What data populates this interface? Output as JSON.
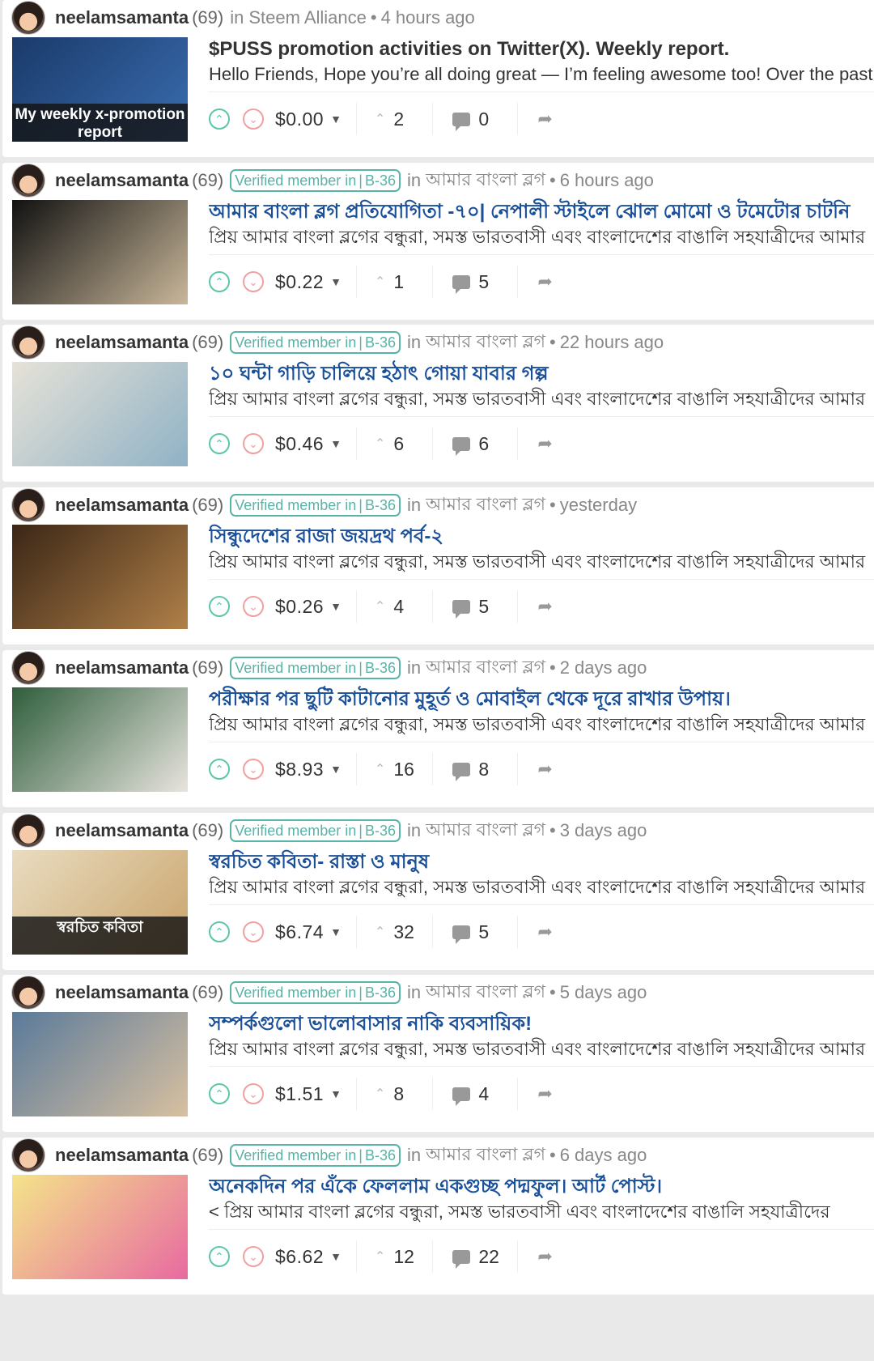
{
  "feed": {
    "posts": [
      {
        "author": "neelamsamanta",
        "reputation": "(69)",
        "badge": null,
        "in_label": "in",
        "community": "Steem Alliance",
        "time": "4 hours ago",
        "title": "$PUSS promotion activities on Twitter(X). Weekly report.",
        "summary": "Hello Friends, Hope you’re all doing great — I’m feeling awesome too! Over the past",
        "thumb_caption": "My weekly x-promotion report",
        "payout": "$0.00",
        "votes": "2",
        "comments": "0",
        "thumb_colors": [
          "#1a3a6a",
          "#3a6db0"
        ]
      },
      {
        "author": "neelamsamanta",
        "reputation": "(69)",
        "badge": {
          "text": "Verified member in",
          "sep": "|",
          "code": "B-36"
        },
        "in_label": "in",
        "community": "আমার বাংলা ব্লগ",
        "time": "6 hours ago",
        "title": "আমার বাংলা ব্লগ প্রতিযোগিতা -৭০| নেপালী স্টাইলে ঝোল মোমো ও টমেটোর চাটনি",
        "summary": "প্রিয় আমার বাংলা ব্লগের বন্ধুরা, সমস্ত ভারতবাসী এবং বাংলাদেশের বাঙালি সহযাত্রীদের আমার",
        "thumb_caption": "",
        "payout": "$0.22",
        "votes": "1",
        "comments": "5",
        "thumb_colors": [
          "#111111",
          "#c9b79a"
        ]
      },
      {
        "author": "neelamsamanta",
        "reputation": "(69)",
        "badge": {
          "text": "Verified member in",
          "sep": "|",
          "code": "B-36"
        },
        "in_label": "in",
        "community": "আমার বাংলা ব্লগ",
        "time": "22 hours ago",
        "title": "১০ ঘন্টা গাড়ি চালিয়ে হঠাৎ গোয়া যাবার গল্প",
        "summary": "প্রিয় আমার বাংলা ব্লগের বন্ধুরা, সমস্ত ভারতবাসী এবং বাংলাদেশের বাঙালি সহযাত্রীদের আমার",
        "thumb_caption": "",
        "payout": "$0.46",
        "votes": "6",
        "comments": "6",
        "thumb_colors": [
          "#e6e2d8",
          "#8fb2c6"
        ]
      },
      {
        "author": "neelamsamanta",
        "reputation": "(69)",
        "badge": {
          "text": "Verified member in",
          "sep": "|",
          "code": "B-36"
        },
        "in_label": "in",
        "community": "আমার বাংলা ব্লগ",
        "time": "yesterday",
        "title": "সিন্ধুদেশের রাজা জয়দ্রথ পর্ব-২",
        "summary": "প্রিয় আমার বাংলা ব্লগের বন্ধুরা, সমস্ত ভারতবাসী এবং বাংলাদেশের বাঙালি সহযাত্রীদের আমার",
        "thumb_caption": "",
        "payout": "$0.26",
        "votes": "4",
        "comments": "5",
        "thumb_colors": [
          "#3b2616",
          "#b08048"
        ]
      },
      {
        "author": "neelamsamanta",
        "reputation": "(69)",
        "badge": {
          "text": "Verified member in",
          "sep": "|",
          "code": "B-36"
        },
        "in_label": "in",
        "community": "আমার বাংলা ব্লগ",
        "time": "2 days ago",
        "title": "পরীক্ষার পর ছুটি কাটানোর মুহূর্ত ও মোবাইল থেকে দূরে রাখার উপায়।",
        "summary": "প্রিয় আমার বাংলা ব্লগের বন্ধুরা, সমস্ত ভারতবাসী এবং বাংলাদেশের বাঙালি সহযাত্রীদের আমার",
        "thumb_caption": "",
        "payout": "$8.93",
        "votes": "16",
        "comments": "8",
        "thumb_colors": [
          "#2f5e3c",
          "#e8e4de"
        ]
      },
      {
        "author": "neelamsamanta",
        "reputation": "(69)",
        "badge": {
          "text": "Verified member in",
          "sep": "|",
          "code": "B-36"
        },
        "in_label": "in",
        "community": "আমার বাংলা ব্লগ",
        "time": "3 days ago",
        "title": "স্বরচিত কবিতা- রাস্তা ও মানুষ",
        "summary": "প্রিয় আমার বাংলা ব্লগের বন্ধুরা, সমস্ত ভারতবাসী এবং বাংলাদেশের বাঙালি সহযাত্রীদের আমার",
        "thumb_caption": "স্বরচিত কবিতা",
        "payout": "$6.74",
        "votes": "32",
        "comments": "5",
        "thumb_colors": [
          "#e9dcc0",
          "#c9a36a"
        ]
      },
      {
        "author": "neelamsamanta",
        "reputation": "(69)",
        "badge": {
          "text": "Verified member in",
          "sep": "|",
          "code": "B-36"
        },
        "in_label": "in",
        "community": "আমার বাংলা ব্লগ",
        "time": "5 days ago",
        "title": "সম্পর্কগুলো ভালোবাসার নাকি ব্যবসায়িক!",
        "summary": "প্রিয় আমার বাংলা ব্লগের বন্ধুরা, সমস্ত ভারতবাসী এবং বাংলাদেশের বাঙালি সহযাত্রীদের আমার",
        "thumb_caption": "",
        "payout": "$1.51",
        "votes": "8",
        "comments": "4",
        "thumb_colors": [
          "#5a7a9a",
          "#d8c0a0"
        ]
      },
      {
        "author": "neelamsamanta",
        "reputation": "(69)",
        "badge": {
          "text": "Verified member in",
          "sep": "|",
          "code": "B-36"
        },
        "in_label": "in",
        "community": "আমার বাংলা ব্লগ",
        "time": "6 days ago",
        "title": "অনেকদিন পর এঁকে ফেললাম একগুচ্ছ পদ্মফুল। আর্ট পোস্ট।",
        "summary": "< প্রিয় আমার বাংলা ব্লগের বন্ধুরা, সমস্ত ভারতবাসী এবং বাংলাদেশের বাঙালি সহযাত্রীদের",
        "thumb_caption": "",
        "payout": "$6.62",
        "votes": "12",
        "comments": "22",
        "thumb_colors": [
          "#f4e48a",
          "#e86aa0"
        ]
      }
    ]
  },
  "colors": {
    "upvote": "#5bc6a8",
    "downvote": "#f0a0a0",
    "badge": "#58b4a6",
    "title_community": "#1a5099",
    "title_default": "#333333"
  },
  "icons": {
    "upvote": "chevron-up-circle-icon",
    "downvote": "chevron-down-circle-icon",
    "dropdown": "caret-down-icon",
    "votes": "chevron-up-icon",
    "comments": "comment-bubble-icon",
    "reblog": "reblog-icon"
  }
}
